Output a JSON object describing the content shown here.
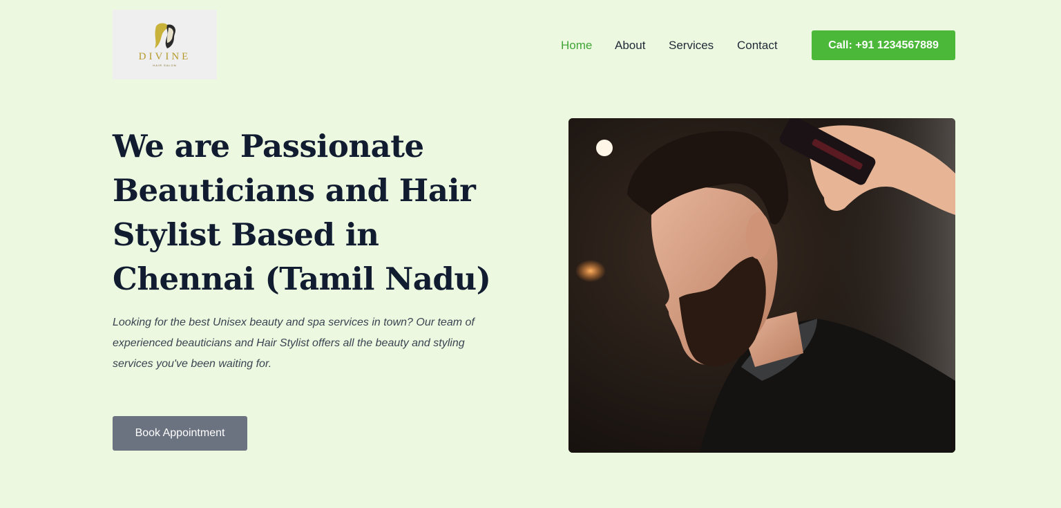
{
  "header": {
    "logo": {
      "word": "DIVINE",
      "subtitle": "HAIR SALON"
    },
    "nav": [
      {
        "label": "Home",
        "active": true
      },
      {
        "label": "About",
        "active": false
      },
      {
        "label": "Services",
        "active": false
      },
      {
        "label": "Contact",
        "active": false
      }
    ],
    "call_button": "Call: +91 1234567889"
  },
  "hero": {
    "title": "We are Passionate Beauticians and Hair Stylist Based in Chennai (Tamil Nadu)",
    "description": "Looking for the best Unisex beauty and spa services in town? Our team of experienced beauticians and Hair Stylist offers all the beauty and styling services you've been waiting for.",
    "book_button": "Book Appointment",
    "image": "man-getting-haircut-photo"
  },
  "colors": {
    "background": "#ecf9e0",
    "accent": "#4cb83a",
    "nav_active": "#3fa535",
    "book_button": "#6b7280",
    "heading": "#111c30"
  }
}
